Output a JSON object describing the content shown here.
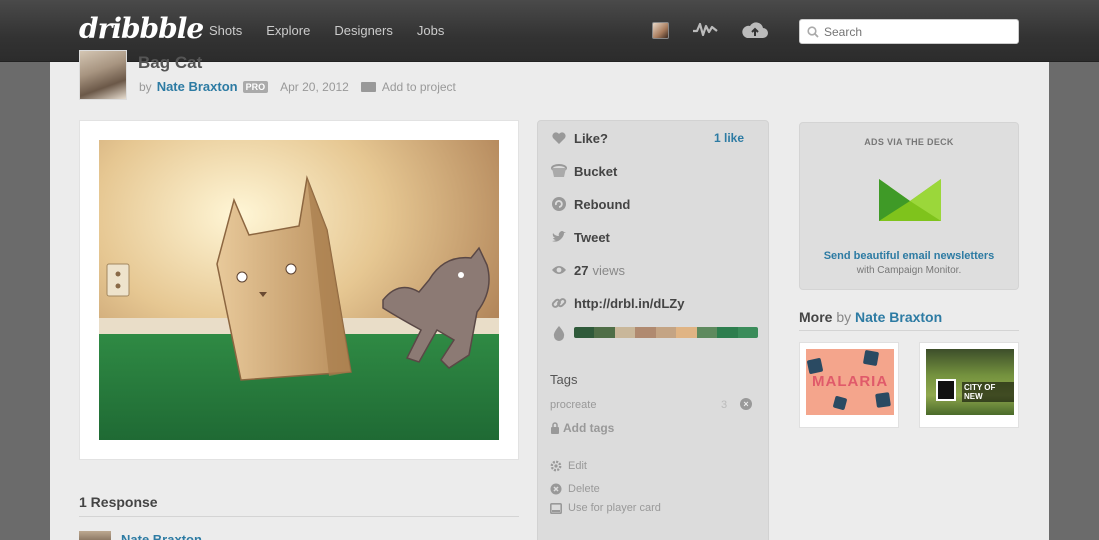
{
  "nav": {
    "logo": "dribbble",
    "links": [
      "Shots",
      "Explore",
      "Designers",
      "Jobs"
    ],
    "search_placeholder": "Search",
    "icons": [
      "avatar-icon",
      "activity-icon",
      "upload-cloud-icon",
      "search-icon"
    ]
  },
  "shot": {
    "title": "Bag Cat",
    "by": "by",
    "author": "Nate Braxton",
    "badge": "PRO",
    "date": "Apr 20, 2012",
    "add_project": "Add to project"
  },
  "actions": {
    "like": "Like?",
    "like_count": "1 like",
    "bucket": "Bucket",
    "rebound": "Rebound",
    "tweet": "Tweet",
    "views_count": "27",
    "views_label": "views",
    "short_url": "http://drbl.in/dLZy",
    "palette": [
      "#2f5a3a",
      "#4f6e47",
      "#c9b79a",
      "#b08a70",
      "#c4a484",
      "#e0b484",
      "#5e8a5e",
      "#2d7e4e",
      "#3a8c5a"
    ],
    "tags_heading": "Tags",
    "tags": [
      {
        "name": "procreate",
        "count": "3"
      }
    ],
    "add_tags": "Add tags",
    "edit": "Edit",
    "delete": "Delete",
    "player_card": "Use for player card"
  },
  "ad": {
    "heading": "ADS VIA THE DECK",
    "link": "Send beautiful email newsletters",
    "sub": "with Campaign Monitor."
  },
  "more": {
    "label": "More",
    "by": "by",
    "author": "Nate Braxton",
    "thumb1_text": "MALARIA",
    "thumb2_text": "CITY OF NEW"
  },
  "responses": {
    "heading": "1 Response",
    "first_author": "Nate Braxton"
  },
  "colors": {
    "accent_link": "#2d7ba3",
    "topbar": "#333333",
    "page_bg": "#ececec"
  }
}
